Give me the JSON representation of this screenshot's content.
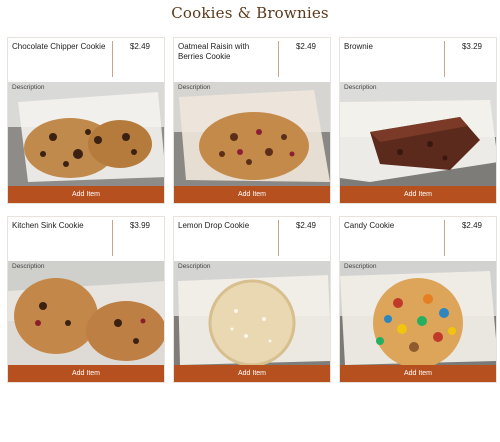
{
  "page": {
    "title": "Cookies & Brownies"
  },
  "cards": [
    {
      "name": "Chocolate Chipper Cookie",
      "price": "$2.49",
      "description_label": "Description",
      "button_label": "Add Item",
      "image_name": "chocolate-chipper-cookie-photo"
    },
    {
      "name": "Oatmeal Raisin with Berries Cookie",
      "price": "$2.49",
      "description_label": "Description",
      "button_label": "Add Item",
      "image_name": "oatmeal-raisin-cookie-photo"
    },
    {
      "name": "Brownie",
      "price": "$3.29",
      "description_label": "Description",
      "button_label": "Add Item",
      "image_name": "brownie-photo"
    },
    {
      "name": "Kitchen Sink Cookie",
      "price": "$3.99",
      "description_label": "Description",
      "button_label": "Add Item",
      "image_name": "kitchen-sink-cookie-photo"
    },
    {
      "name": "Lemon Drop Cookie",
      "price": "$2.49",
      "description_label": "Description",
      "button_label": "Add Item",
      "image_name": "lemon-drop-cookie-photo"
    },
    {
      "name": "Candy Cookie",
      "price": "$2.49",
      "description_label": "Description",
      "button_label": "Add Item",
      "image_name": "candy-cookie-photo"
    }
  ],
  "colors": {
    "accent": "#b6501e",
    "title": "#5a3a1c",
    "divider": "#c7a48a"
  }
}
